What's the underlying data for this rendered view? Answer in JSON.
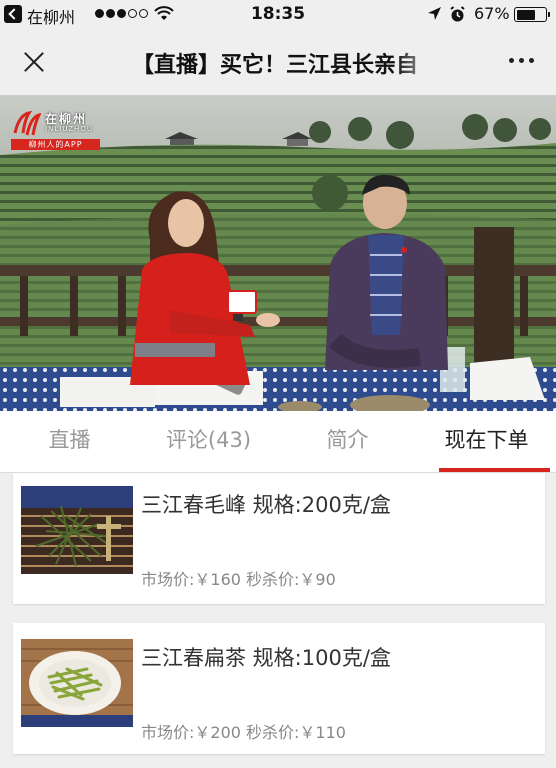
{
  "status_bar": {
    "carrier": "在柳州",
    "time": "18:35",
    "battery": "67%",
    "battery_level": 0.67
  },
  "nav": {
    "title": "【直播】买它！三江县长亲自"
  },
  "video": {
    "logo_name": "在柳州",
    "logo_sub": "INLIUZHOU",
    "logo_slogan": "柳州人的APP"
  },
  "tabs": [
    {
      "label": "直播",
      "active": false
    },
    {
      "label": "评论(43)",
      "active": false
    },
    {
      "label": "简介",
      "active": false
    },
    {
      "label": "现在下单",
      "active": true
    }
  ],
  "products": [
    {
      "name": "三江春毛峰 规格:200克/盒",
      "price": "市场价:￥160 秒杀价:￥90"
    },
    {
      "name": "三江春扁茶 规格:100克/盒",
      "price": "市场价:￥200 秒杀价:￥110"
    }
  ],
  "colors": {
    "accent": "#d7261e",
    "background": "#efefef"
  }
}
